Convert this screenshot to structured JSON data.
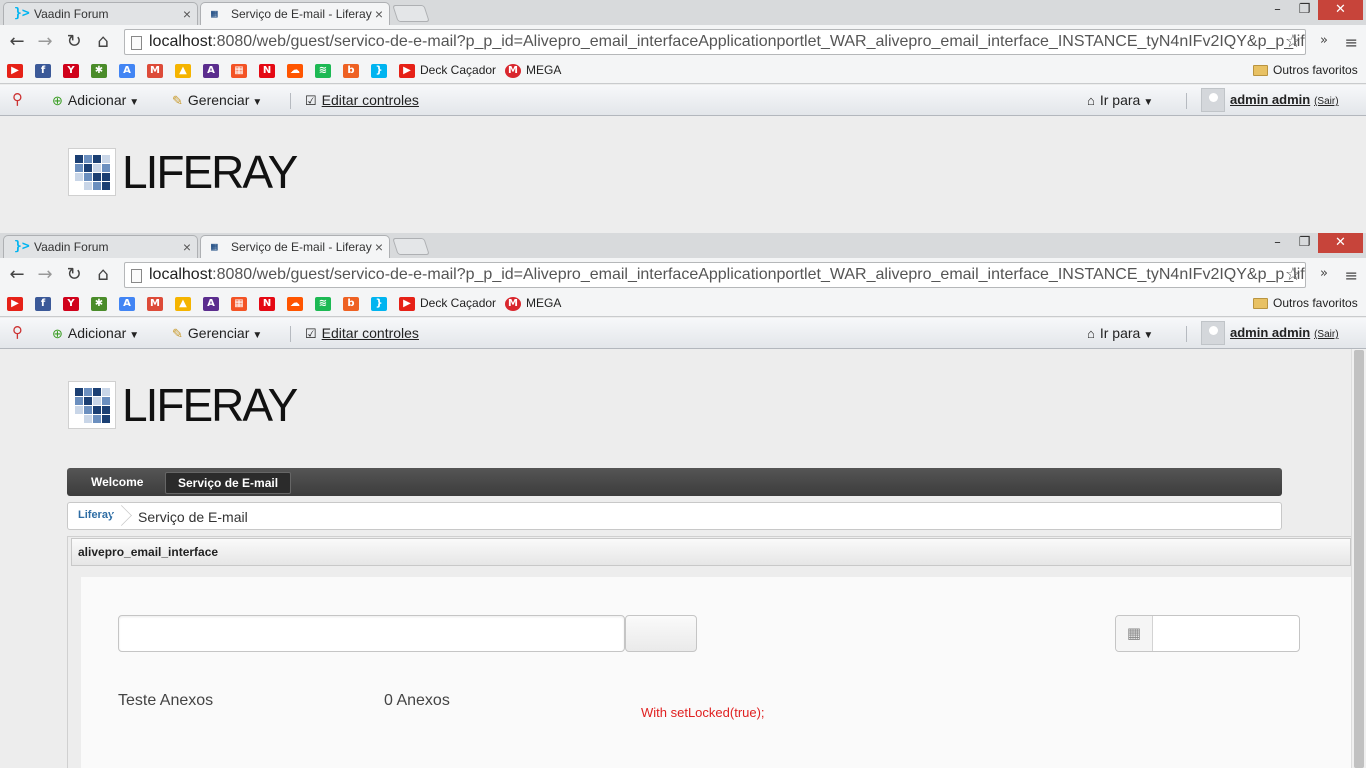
{
  "browser": {
    "tabs": [
      {
        "title": "Vaadin Forum",
        "favicon": "vaadin-icon",
        "active": false
      },
      {
        "title": "Serviço de E-mail - Liferay",
        "favicon": "liferay-icon",
        "active": true
      }
    ],
    "close_glyph": "×",
    "window_controls": {
      "minimize": "–",
      "maximize": "❐",
      "close": "✕"
    },
    "url_host": "localhost",
    "url_rest": ":8080/web/guest/servico-de-e-mail?p_p_id=Alivepro_email_interfaceApplicationportlet_WAR_alivepro_email_interface_INSTANCE_tyN4nIFv2IQY&p_p_life",
    "nav_glyphs": {
      "back": "←",
      "forward": "→",
      "reload": "↻",
      "home": "⌂",
      "star": "☆",
      "menu": "≡",
      "more": "»"
    },
    "bookmarks": [
      {
        "icon": "youtube-icon",
        "color": "#e62117",
        "glyph": "▶"
      },
      {
        "icon": "facebook-icon",
        "color": "#3b5998",
        "glyph": "f"
      },
      {
        "icon": "yahoo-icon",
        "color": "#d0021b",
        "glyph": "Y"
      },
      {
        "icon": "gear-bookmark-icon",
        "color": "#4a8c2a",
        "glyph": "✱"
      },
      {
        "icon": "translate-icon",
        "color": "#4285f4",
        "glyph": "A"
      },
      {
        "icon": "gmail-icon",
        "color": "#dd4b39",
        "glyph": "M"
      },
      {
        "icon": "drive-icon",
        "color": "#f5b400",
        "glyph": "▲"
      },
      {
        "icon": "aplus-icon",
        "color": "#5b2d8e",
        "glyph": "A"
      },
      {
        "icon": "windows-icon",
        "color": "#f35325",
        "glyph": "▦"
      },
      {
        "icon": "netflix-icon",
        "color": "#e50914",
        "glyph": "N"
      },
      {
        "icon": "soundcloud-icon",
        "color": "#ff5500",
        "glyph": "☁"
      },
      {
        "icon": "spotify-icon",
        "color": "#1db954",
        "glyph": "≋"
      },
      {
        "icon": "bitly-icon",
        "color": "#ee6123",
        "glyph": "b"
      },
      {
        "icon": "vaadin-bookmark-icon",
        "color": "#00b4f0",
        "glyph": "}"
      }
    ],
    "bookmark_labels": {
      "deck": "Deck Caçador",
      "mega": "MEGA",
      "other": "Outros favoritos"
    }
  },
  "dockbar": {
    "add": "Adicionar",
    "manage": "Gerenciar",
    "edit_controls": "Editar controles",
    "go_to": "Ir para",
    "user": "admin admin",
    "signout": "(Sair)",
    "caret": "▼",
    "check": "☑",
    "plus": "⊕",
    "pencil": "✎",
    "home": "⌂"
  },
  "site": {
    "logo_text": "LIFERAY",
    "nav": [
      "Welcome",
      "Serviço de E-mail"
    ],
    "breadcrumb_root": "Liferay",
    "breadcrumb_current": "Serviço de E-mail"
  },
  "portlet": {
    "title": "alivepro_email_interface",
    "attachments_label": "Teste Anexos",
    "attachments_count": "0 Anexos",
    "note": "With setLocked(true);",
    "calendar_glyph": "▦",
    "note_color": "#e02020"
  }
}
